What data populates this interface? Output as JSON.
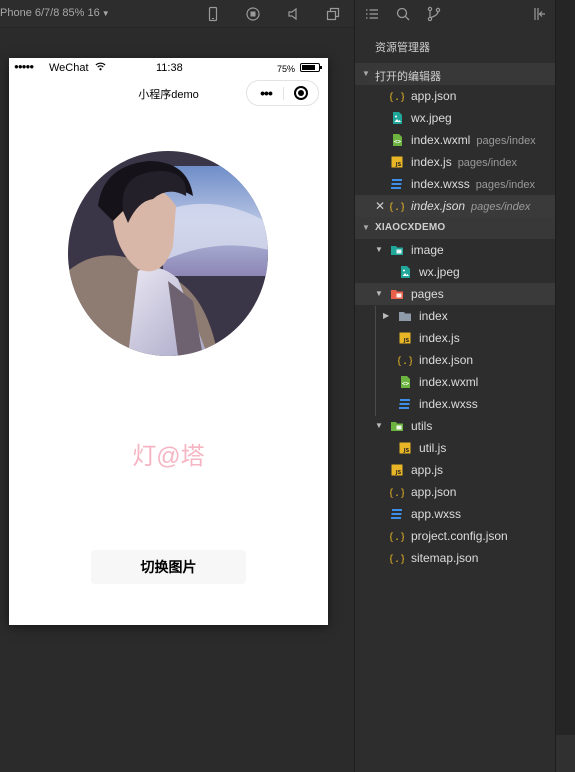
{
  "simulator": {
    "device_label": "Phone 6/7/8 85% 16",
    "status_bar": {
      "signal": "●●●●●",
      "carrier": "WeChat",
      "time": "11:38",
      "battery": "75%"
    },
    "nav_title": "小程序demo",
    "brand_text": "灯@塔",
    "switch_button": "切换图片"
  },
  "explorer": {
    "title": "资源管理器",
    "open_editors_header": "打开的编辑器",
    "open_editors": [
      {
        "name": "app.json",
        "path": "",
        "icon": "json-icon"
      },
      {
        "name": "wx.jpeg",
        "path": "",
        "icon": "image-file-icon"
      },
      {
        "name": "index.wxml",
        "path": "pages/index",
        "icon": "wxml-icon"
      },
      {
        "name": "index.js",
        "path": "pages/index",
        "icon": "js-icon"
      },
      {
        "name": "index.wxss",
        "path": "pages/index",
        "icon": "wxss-icon"
      },
      {
        "name": "index.json",
        "path": "pages/index",
        "icon": "json-icon"
      }
    ],
    "project_header": "XIAOCXDEMO",
    "tree": [
      {
        "name": "image",
        "icon": "image-folder-icon"
      },
      {
        "name": "wx.jpeg",
        "icon": "image-file-icon"
      },
      {
        "name": "pages",
        "icon": "pages-folder-icon"
      },
      {
        "name": "index",
        "icon": "folder-icon"
      },
      {
        "name": "index.js",
        "icon": "js-icon"
      },
      {
        "name": "index.json",
        "icon": "json-icon"
      },
      {
        "name": "index.wxml",
        "icon": "wxml-icon"
      },
      {
        "name": "index.wxss",
        "icon": "wxss-icon"
      },
      {
        "name": "utils",
        "icon": "utils-folder-icon"
      },
      {
        "name": "util.js",
        "icon": "js-icon"
      },
      {
        "name": "app.js",
        "icon": "js-icon"
      },
      {
        "name": "app.json",
        "icon": "json-icon"
      },
      {
        "name": "app.wxss",
        "icon": "wxss-icon"
      },
      {
        "name": "project.config.json",
        "icon": "json-icon"
      },
      {
        "name": "sitemap.json",
        "icon": "json-icon"
      }
    ]
  },
  "colors": {
    "brand_text": "#f5b5c3",
    "js": "#e8b526",
    "json": "#e8b526",
    "wxml": "#6cb33f",
    "wxss": "#3b8fe8",
    "image": "#21a79a",
    "pages_folder": "#e8604c"
  }
}
